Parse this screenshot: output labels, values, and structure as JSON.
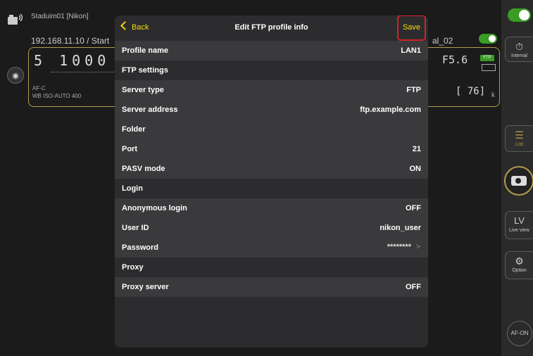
{
  "background": {
    "camera_name": "Staduim01 [Nikon]",
    "address": "192.168.11.10 / Start",
    "address_right": "al_02",
    "lcd": {
      "shutter": "5  1000",
      "aperture": "F5.6",
      "ftp_badge": "FTP",
      "info_line1": "AF-C",
      "info_line2": "WB  ISO-AUTO 400",
      "count": "[ 76]",
      "frame_suffix": "k"
    }
  },
  "toolbar": {
    "interval_label": "Interval",
    "list_label": "List",
    "lv_icon_text": "LV",
    "lv_label": "Live view",
    "option_label": "Option",
    "af_on_label": "AF-ON"
  },
  "modal": {
    "back_label": "Back",
    "title": "Edit FTP profile info",
    "save_label": "Save",
    "rows": [
      {
        "label": "Profile name",
        "value": "LAN1"
      },
      {
        "label": "FTP settings",
        "value": ""
      },
      {
        "label": "Server type",
        "value": "FTP"
      },
      {
        "label": "Server address",
        "value": "ftp.example.com"
      },
      {
        "label": "Folder",
        "value": ""
      },
      {
        "label": "Port",
        "value": "21"
      },
      {
        "label": "PASV mode",
        "value": "ON"
      },
      {
        "label": "Login",
        "value": ""
      },
      {
        "label": "Anonymous login",
        "value": "OFF"
      },
      {
        "label": "User ID",
        "value": "nikon_user"
      },
      {
        "label": "Password",
        "value": "********"
      },
      {
        "label": "Proxy",
        "value": ""
      },
      {
        "label": "Proxy server",
        "value": "OFF"
      }
    ]
  },
  "colors": {
    "accent": "#f5d90a",
    "highlight_border": "#d6202a",
    "toggle_on": "#3a9c24",
    "panel_border": "#b49a4a"
  }
}
